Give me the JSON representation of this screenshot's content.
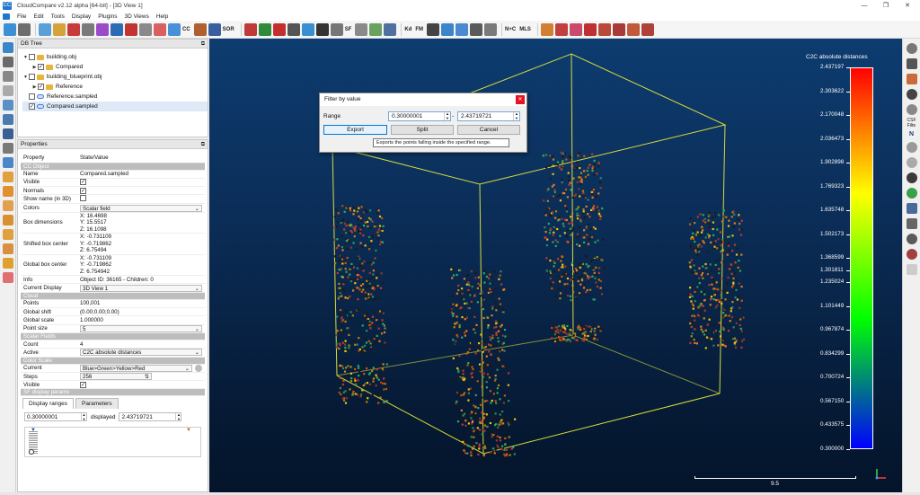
{
  "window": {
    "title": "CloudCompare v2.12 alpha [64-bit] - [3D View 1]",
    "icon_label": "CC",
    "minimize": "—",
    "maximize": "❐",
    "close": "✕"
  },
  "menu": [
    "File",
    "Edit",
    "Tools",
    "Display",
    "Plugins",
    "3D Views",
    "Help"
  ],
  "toolbar": {
    "labels": {
      "cc": "CC",
      "sor": "SOR",
      "sf": "SF",
      "kd": "Kd",
      "fm": "FM",
      "nc": "N+C",
      "mls": "MLS"
    }
  },
  "db_tree": {
    "title": "DB Tree",
    "items": [
      {
        "label": "building.obj",
        "level": 0,
        "expanded": true,
        "checked": false,
        "icon": "folder-icon"
      },
      {
        "label": "Compared",
        "level": 1,
        "expanded": false,
        "checked": true,
        "icon": "folder-icon"
      },
      {
        "label": "building_blueprint.obj",
        "level": 0,
        "expanded": true,
        "checked": false,
        "icon": "folder-icon"
      },
      {
        "label": "Reference",
        "level": 1,
        "expanded": false,
        "checked": true,
        "icon": "folder-icon"
      },
      {
        "label": "Reference.sampled",
        "level": 0,
        "expanded": false,
        "checked": false,
        "icon": "cloud-icon"
      },
      {
        "label": "Compared.sampled",
        "level": 0,
        "expanded": false,
        "checked": true,
        "icon": "cloud-icon",
        "selected": true
      }
    ]
  },
  "properties": {
    "title": "Properties",
    "header": {
      "property": "Property",
      "value": "State/Value"
    },
    "sections": {
      "cc_object": "CC Object",
      "cloud": "Cloud",
      "scalar_fields": "Scalar Fields",
      "color_scale": "Color Scale",
      "sf_display": "SF display params"
    },
    "cc_object": {
      "name_k": "Name",
      "name_v": "Compared.sampled",
      "visible_k": "Visible",
      "normals_k": "Normals",
      "show_name_k": "Show name (in 3D)",
      "colors_k": "Colors",
      "colors_v": "Scalar field",
      "box_dim_k": "Box dimensions",
      "box_dim_x": "X: 16.4698",
      "box_dim_y": "Y: 15.5517",
      "box_dim_z": "Z: 16.1098",
      "shifted_k": "Shifted box center",
      "shifted_x": "X: -0.731109",
      "shifted_y": "Y: -0.719862",
      "shifted_z": "Z: 6.75494",
      "global_k": "Global box center",
      "global_x": "X: -0.731109",
      "global_y": "Y: -0.719862",
      "global_z": "Z: 6.754942",
      "info_k": "Info",
      "info_v": "Object ID: 36165 - Children: 0",
      "display_k": "Current Display",
      "display_v": "3D View 1"
    },
    "cloud": {
      "points_k": "Points",
      "points_v": "100,001",
      "shift_k": "Global shift",
      "shift_v": "(0.00;0.00;0.00)",
      "scale_k": "Global scale",
      "scale_v": "1.000000",
      "psize_k": "Point size",
      "psize_v": "5"
    },
    "sf": {
      "count_k": "Count",
      "count_v": "4",
      "active_k": "Active",
      "active_v": "C2C absolute distances"
    },
    "color_scale": {
      "current_k": "Current",
      "current_v": "Blue>Green>Yellow>Red",
      "steps_k": "Steps",
      "steps_v": "256",
      "visible_k": "Visible"
    },
    "sf_display": {
      "tab_ranges": "Display ranges",
      "tab_params": "Parameters",
      "min_value": "0.30000001",
      "displayed_label": "displayed",
      "max_value": "2.43719721"
    }
  },
  "dialog": {
    "title": "Filter by value",
    "range_label": "Range",
    "min": "0.30000001",
    "dash": "-",
    "max": "2.43719721",
    "export": "Export",
    "split": "Split",
    "cancel": "Cancel",
    "close": "✕",
    "tooltip": "Exports the points falling inside the specified range."
  },
  "color_scale_legend": {
    "title": "C2C absolute distances",
    "values": [
      "2.437197",
      "2.303622",
      "2.170048",
      "2.036473",
      "1.902898",
      "1.769323",
      "1.635748",
      "1.502173",
      "1.368599",
      "1.301811",
      "1.235024",
      "1.101449",
      "0.967874",
      "0.834299",
      "0.700724",
      "0.567150",
      "0.433575",
      "0.300000"
    ],
    "colors": {
      "top": "#ff0000",
      "upper": "#ffff00",
      "lower": "#00ff00",
      "bottom": "#0000ff"
    }
  },
  "scale_bar": {
    "value": "9.5"
  },
  "right_toolbar": {
    "csf_label": "CSF Filte",
    "n_label": "N"
  }
}
